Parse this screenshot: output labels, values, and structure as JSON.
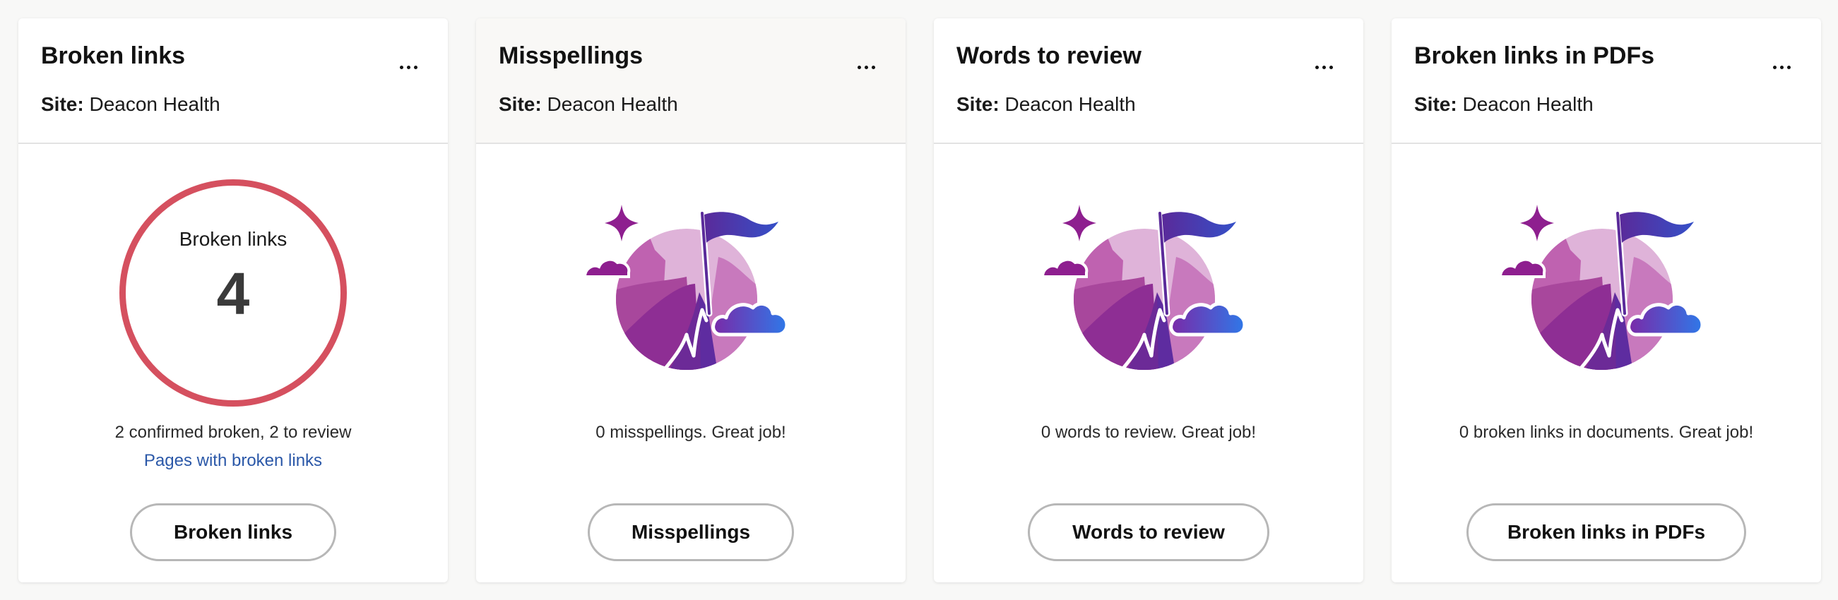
{
  "cards": [
    {
      "title": "Broken links",
      "site_label": "Site:",
      "site_name": "Deacon Health",
      "ring_label": "Broken links",
      "count": "4",
      "summary": "2 confirmed broken, 2 to review",
      "link_text": "Pages with broken links",
      "button_label": "Broken links",
      "ring_color": "#d5505f"
    },
    {
      "title": "Misspellings",
      "site_label": "Site:",
      "site_name": "Deacon Health",
      "summary": "0 misspellings. Great job!",
      "button_label": "Misspellings"
    },
    {
      "title": "Words to review",
      "site_label": "Site:",
      "site_name": "Deacon Health",
      "summary": "0 words to review. Great job!",
      "button_label": "Words to review"
    },
    {
      "title": "Broken links in PDFs",
      "site_label": "Site:",
      "site_name": "Deacon Health",
      "summary": "0 broken links in documents. Great job!",
      "button_label": "Broken links in PDFs"
    }
  ],
  "icons": {
    "menu": "more-options-icon",
    "illustration": "success-flag-illustration"
  },
  "colors": {
    "accent_link": "#2b58a8",
    "alert_ring": "#d5505f",
    "illustration_purple": "#8e1f8f",
    "illustration_blue": "#2f6fe0"
  }
}
